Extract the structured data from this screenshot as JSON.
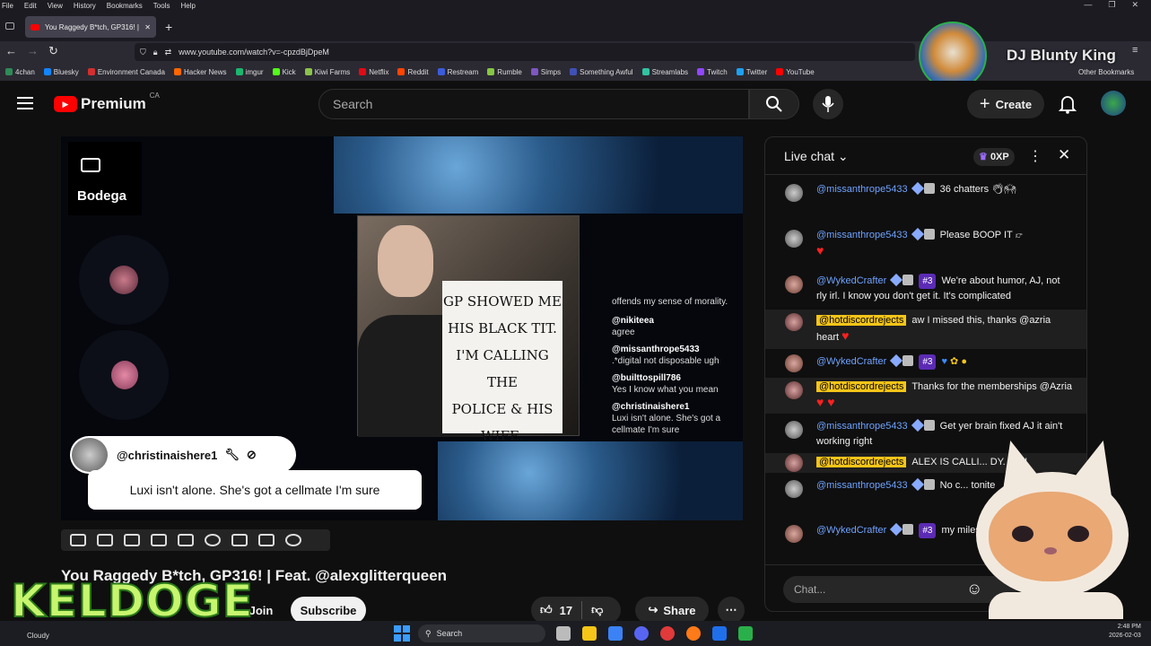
{
  "menu": [
    "File",
    "Edit",
    "View",
    "History",
    "Bookmarks",
    "Tools",
    "Help"
  ],
  "tab": {
    "title": "You Raggedy B*tch, GP316! | Fe"
  },
  "url": "www.youtube.com/watch?v=-cpzdBjDpeM",
  "bookmarks": [
    {
      "label": "4chan",
      "color": "#2e8b57"
    },
    {
      "label": "Bluesky",
      "color": "#1185fe"
    },
    {
      "label": "Environment Canada",
      "color": "#d32f2f"
    },
    {
      "label": "Hacker News",
      "color": "#ff6600"
    },
    {
      "label": "imgur",
      "color": "#1bb76e"
    },
    {
      "label": "Kick",
      "color": "#53fc18"
    },
    {
      "label": "Kiwi Farms",
      "color": "#8bc34a"
    },
    {
      "label": "Netflix",
      "color": "#e50914"
    },
    {
      "label": "Reddit",
      "color": "#ff4500"
    },
    {
      "label": "Restream",
      "color": "#3b5bdb"
    },
    {
      "label": "Rumble",
      "color": "#85c742"
    },
    {
      "label": "Simps",
      "color": "#7e57c2"
    },
    {
      "label": "Something Awful",
      "color": "#3f51b5"
    },
    {
      "label": "Streamlabs",
      "color": "#31c3a2"
    },
    {
      "label": "Twitch",
      "color": "#9146ff"
    },
    {
      "label": "Twitter",
      "color": "#1da1f2"
    },
    {
      "label": "YouTube",
      "color": "#ff0000"
    }
  ],
  "other_bookmarks": "Other Bookmarks",
  "overlay_name": "DJ Blunty King",
  "logo": {
    "word": "Premium",
    "region": "CA"
  },
  "search": {
    "placeholder": "Search"
  },
  "create_label": "Create",
  "video": {
    "bodega": "Bodega",
    "sign_lines": [
      "GP SHOWED ME",
      "HIS BLACK TIT.",
      "I'M CALLING THE",
      "POLICE & HIS",
      "WIFE."
    ],
    "stream_chat": [
      {
        "text": "offends my sense of morality."
      },
      {
        "user": "@nikiteea",
        "text": "agree"
      },
      {
        "user": "@missanthrope5433",
        "text": ".*digital not disposable ugh"
      },
      {
        "user": "@builttospill786",
        "text": "Yes I know what you mean"
      },
      {
        "user": "@christinaishere1",
        "text": "Luxi isn't alone. She's got a cellmate I'm sure"
      }
    ],
    "caption_user": "@christinaishere1",
    "caption_text": "Luxi isn't alone. She's got a cellmate I'm sure"
  },
  "title": "You Raggedy B*tch, GP316! | Feat. @alexglitterqueen",
  "join_label": "Join",
  "subscribe_label": "Subscribe",
  "likes": "17",
  "share_label": "Share",
  "chat": {
    "header": "Live chat",
    "xp": "0XP",
    "input_placeholder": "Chat...",
    "messages": [
      {
        "author": "@missanthrope5433",
        "text": "36 chatters"
      },
      {
        "author": "@missanthrope5433",
        "text": "Please BOOP IT"
      },
      {
        "author": "@WykedCrafter",
        "rank": "#3",
        "text": "We're about humor, AJ, not rly irl. I know you don't get it. It's complicated"
      },
      {
        "author": "@hotdiscordrejects",
        "text": "aw I missed this, thanks @azria heart"
      },
      {
        "author": "@WykedCrafter",
        "rank": "#3",
        "text": ""
      },
      {
        "author": "@hotdiscordrejects",
        "text": "Thanks for the memberships @Azria"
      },
      {
        "author": "@missanthrope5433",
        "text": "Get yer brain fixed AJ it ain't working right"
      },
      {
        "author": "@hotdiscordrejects",
        "text": "ALEX IS CALLI... DY. A !!!!"
      },
      {
        "author": "@missanthrope5433",
        "text": "No c... tonite"
      },
      {
        "author": "@WykedCrafter",
        "rank": "#3",
        "text": "my milestone but I won't def..."
      }
    ]
  },
  "keldoge": "KELDOGE",
  "taskbar": {
    "weather": "Cloudy",
    "search": "Search",
    "time": "2:48 PM",
    "date": "2026-02-03"
  }
}
